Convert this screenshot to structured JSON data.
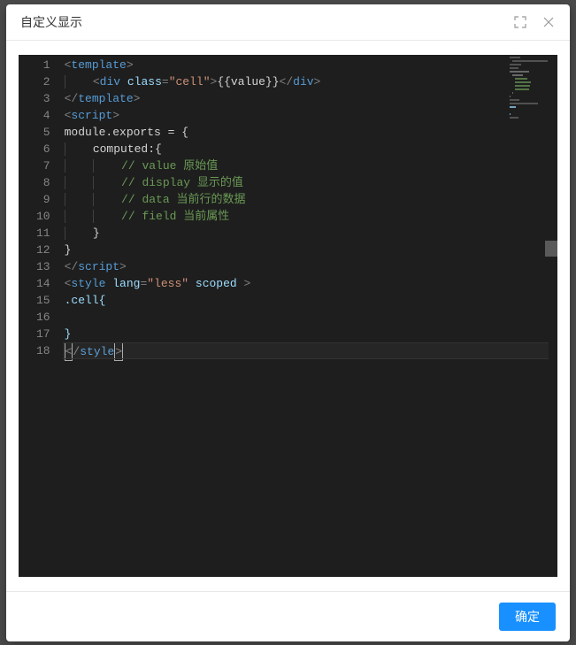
{
  "dialog": {
    "title": "自定义显示",
    "confirm_label": "确定"
  },
  "editor": {
    "line_count": 18,
    "current_line": 18,
    "lines": [
      {
        "n": 1,
        "indent": 0,
        "segments": [
          {
            "t": "<",
            "c": "tag"
          },
          {
            "t": "template",
            "c": "tag-name"
          },
          {
            "t": ">",
            "c": "tag"
          }
        ]
      },
      {
        "n": 2,
        "indent": 1,
        "segments": [
          {
            "t": "<",
            "c": "tag"
          },
          {
            "t": "div",
            "c": "tag-name"
          },
          {
            "t": " ",
            "c": "text"
          },
          {
            "t": "class",
            "c": "attr-name"
          },
          {
            "t": "=",
            "c": "punct"
          },
          {
            "t": "\"cell\"",
            "c": "attr-value"
          },
          {
            "t": ">",
            "c": "tag"
          },
          {
            "t": "{{value}}",
            "c": "text"
          },
          {
            "t": "</",
            "c": "tag"
          },
          {
            "t": "div",
            "c": "tag-name"
          },
          {
            "t": ">",
            "c": "tag"
          }
        ]
      },
      {
        "n": 3,
        "indent": 0,
        "segments": [
          {
            "t": "</",
            "c": "tag"
          },
          {
            "t": "template",
            "c": "tag-name"
          },
          {
            "t": ">",
            "c": "tag"
          }
        ]
      },
      {
        "n": 4,
        "indent": 0,
        "segments": [
          {
            "t": "<",
            "c": "tag"
          },
          {
            "t": "script",
            "c": "tag-name"
          },
          {
            "t": ">",
            "c": "tag"
          }
        ]
      },
      {
        "n": 5,
        "indent": 0,
        "segments": [
          {
            "t": "module.exports = {",
            "c": "text"
          }
        ]
      },
      {
        "n": 6,
        "indent": 1,
        "segments": [
          {
            "t": "computed:{",
            "c": "text"
          }
        ]
      },
      {
        "n": 7,
        "indent": 2,
        "segments": [
          {
            "t": "// value 原始值",
            "c": "comment"
          }
        ]
      },
      {
        "n": 8,
        "indent": 2,
        "segments": [
          {
            "t": "// display 显示的值",
            "c": "comment"
          }
        ]
      },
      {
        "n": 9,
        "indent": 2,
        "segments": [
          {
            "t": "// data 当前行的数据",
            "c": "comment"
          }
        ]
      },
      {
        "n": 10,
        "indent": 2,
        "segments": [
          {
            "t": "// field 当前属性",
            "c": "comment"
          }
        ]
      },
      {
        "n": 11,
        "indent": 1,
        "segments": [
          {
            "t": "}",
            "c": "text"
          }
        ]
      },
      {
        "n": 12,
        "indent": 0,
        "segments": [
          {
            "t": "}",
            "c": "text"
          }
        ]
      },
      {
        "n": 13,
        "indent": 0,
        "segments": [
          {
            "t": "</",
            "c": "tag"
          },
          {
            "t": "script",
            "c": "tag-name"
          },
          {
            "t": ">",
            "c": "tag"
          }
        ]
      },
      {
        "n": 14,
        "indent": 0,
        "segments": [
          {
            "t": "<",
            "c": "tag"
          },
          {
            "t": "style",
            "c": "tag-name"
          },
          {
            "t": " ",
            "c": "text"
          },
          {
            "t": "lang",
            "c": "attr-name"
          },
          {
            "t": "=",
            "c": "punct"
          },
          {
            "t": "\"less\"",
            "c": "attr-value"
          },
          {
            "t": " ",
            "c": "text"
          },
          {
            "t": "scoped",
            "c": "attr-name"
          },
          {
            "t": " >",
            "c": "tag"
          }
        ]
      },
      {
        "n": 15,
        "indent": 0,
        "segments": [
          {
            "t": ".cell{",
            "c": "attr-name"
          }
        ]
      },
      {
        "n": 16,
        "indent": 0,
        "segments": []
      },
      {
        "n": 17,
        "indent": 0,
        "segments": [
          {
            "t": "}",
            "c": "attr-name"
          }
        ]
      },
      {
        "n": 18,
        "indent": 0,
        "segments": [
          {
            "t": "<",
            "c": "tag",
            "box": true
          },
          {
            "t": "/",
            "c": "tag"
          },
          {
            "t": "style",
            "c": "tag-name"
          },
          {
            "t": ">",
            "c": "tag",
            "box": true
          }
        ]
      }
    ]
  }
}
